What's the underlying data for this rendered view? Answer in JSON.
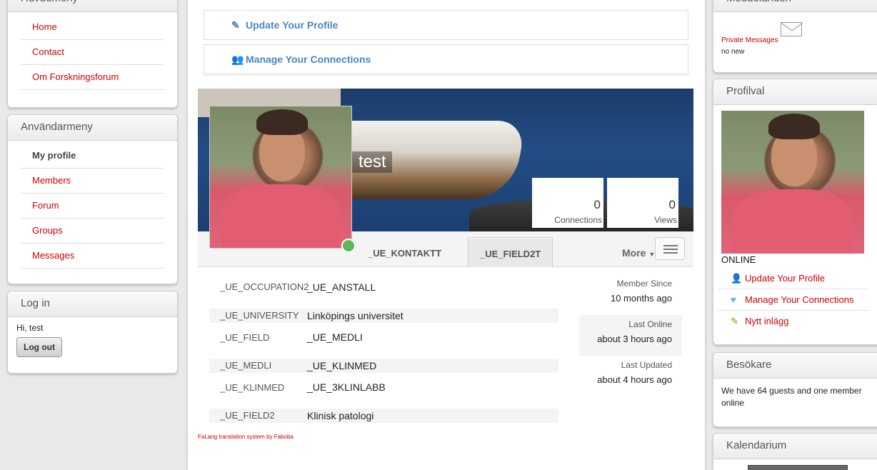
{
  "left": {
    "main_menu": {
      "title": "Huvudmeny",
      "items": [
        {
          "label": "Home"
        },
        {
          "label": "Contact"
        },
        {
          "label": "Om Forskningsforum"
        }
      ]
    },
    "user_menu": {
      "title": "Användarmeny",
      "items": [
        {
          "label": "My profile",
          "active": true
        },
        {
          "label": "Members"
        },
        {
          "label": "Forum"
        },
        {
          "label": "Groups"
        },
        {
          "label": "Messages"
        }
      ]
    },
    "login": {
      "title": "Log in",
      "greeting": "Hi, test",
      "logout_label": "Log out"
    }
  },
  "center": {
    "actions": {
      "update_profile": "Update Your Profile",
      "manage_connections": "Manage Your Connections"
    },
    "cover": {
      "name": "test",
      "stats": [
        {
          "value": "0",
          "label": "Connections"
        },
        {
          "value": "0",
          "label": "Views"
        }
      ]
    },
    "tabs": [
      {
        "label": "_UE_KONTAKTT"
      },
      {
        "label": "_UE_FIELD2T",
        "selected": true
      }
    ],
    "more_label": "More",
    "fields": [
      {
        "key": "_UE_OCCUPATION2",
        "value": "_UE_ANSTALL"
      },
      {
        "key": "_UE_UNIVERSITY",
        "value": "Linköpings universitet"
      },
      {
        "key": "_UE_FIELD",
        "value": "_UE_MEDLI"
      },
      {
        "key": "_UE_MEDLI",
        "value": "_UE_KLINMED"
      },
      {
        "key": "_UE_KLINMED",
        "value": "_UE_3KLINLABB"
      },
      {
        "key": "_UE_FIELD2",
        "value": "Klinisk patologi"
      }
    ],
    "meta": [
      {
        "label": "Member Since",
        "value": "10 months ago"
      },
      {
        "label": "Last Online",
        "value": "about 3 hours ago"
      },
      {
        "label": "Last Updated",
        "value": "about 4 hours ago"
      }
    ],
    "footer_note": "FaLang translation system by Faboba"
  },
  "right": {
    "messages": {
      "title": "Meddelanden",
      "link": "Private Messages",
      "status": "no new"
    },
    "profile_box": {
      "title": "Profilval",
      "status": "ONLINE",
      "links": [
        {
          "label": "Update Your Profile",
          "icon": "user-edit-icon"
        },
        {
          "label": "Manage Your Connections",
          "icon": "heart-icon"
        },
        {
          "label": "Nytt inlägg",
          "icon": "pencil-note-icon"
        }
      ]
    },
    "visitors": {
      "title": "Besökare",
      "text": "We have 64 guests and one member online"
    },
    "calendar": {
      "title": "Kalendarium"
    }
  },
  "colors": {
    "link_red": "#cc0000",
    "action_blue": "#4a86c5",
    "online_green": "#5cb85c"
  }
}
